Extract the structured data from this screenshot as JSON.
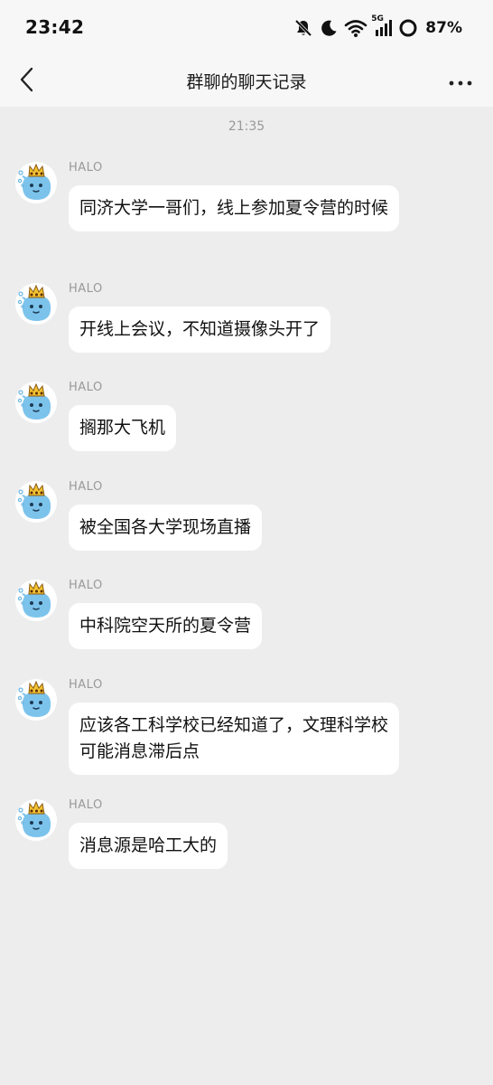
{
  "status_bar": {
    "time": "23:42",
    "network": "5G",
    "battery": "87%",
    "icons": [
      "mute-bell-icon",
      "moon-icon",
      "wifi-icon",
      "signal-icon",
      "battery-ring-icon"
    ]
  },
  "header": {
    "title": "群聊的聊天记录",
    "back_icon": "chevron-left-icon",
    "more_icon": "more-dots-icon"
  },
  "chat": {
    "timestamp": "21:35",
    "messages": [
      {
        "sender": "HALO",
        "text": "同济大学一哥们，线上参加夏令营的时候"
      },
      {
        "sender": "HALO",
        "text": "开线上会议，不知道摄像头开了"
      },
      {
        "sender": "HALO",
        "text": "搁那大飞机"
      },
      {
        "sender": "HALO",
        "text": "被全国各大学现场直播"
      },
      {
        "sender": "HALO",
        "text": "中科院空天所的夏令营"
      },
      {
        "sender": "HALO",
        "text": "应该各工科学校已经知道了，文理科学校可能消息滞后点"
      },
      {
        "sender": "HALO",
        "text": "消息源是哈工大的"
      }
    ]
  }
}
